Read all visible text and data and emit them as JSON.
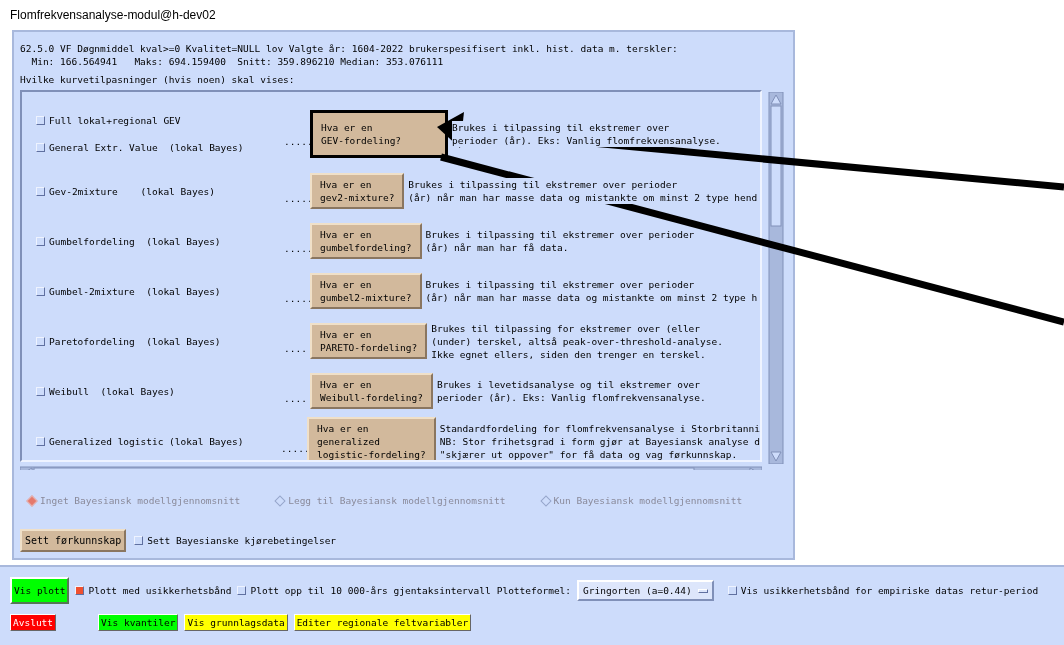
{
  "window": {
    "title": "Flomfrekvensanalyse-modul@h-dev02"
  },
  "header": {
    "lines": [
      "62.5.0 VF Døgnmiddel kval>=0 Kvalitet=NULL lov Valgte år: 1604-2022 brukerspesifisert inkl. hist. data m. terskler:",
      "  Min: 166.564941   Maks: 694.159400  Snitt: 359.896210 Median: 353.076111"
    ],
    "question": "Hvilke kurvetilpasninger (hvis noen) skal vises:"
  },
  "distributions": [
    {
      "options": [
        {
          "label": "Full lokal+regional GEV",
          "checked": false
        },
        {
          "label": "General Extr. Value  (lokal Bayes)",
          "checked": false
        }
      ],
      "dots": ".....",
      "button": {
        "lines": [
          "Hva er en",
          "GEV-fordeling?"
        ],
        "focused": true
      },
      "description": [
        "Brukes i tilpassing til ekstremer over",
        "perioder (år). Eks: Vanlig flomfrekvensanalyse."
      ]
    },
    {
      "options": [
        {
          "label": "Gev-2mixture    (lokal Bayes)",
          "checked": false
        }
      ],
      "dots": ".....",
      "button": {
        "lines": [
          "Hva er en",
          "gev2-mixture?"
        ],
        "focused": false
      },
      "description": [
        "Brukes i tilpassing til ekstremer over perioder",
        "(år) når man har masse data og mistankte om minst 2 type hend"
      ]
    },
    {
      "options": [
        {
          "label": "Gumbelfordeling  (lokal Bayes)",
          "checked": false
        }
      ],
      "dots": ".....",
      "button": {
        "lines": [
          "Hva er en",
          "gumbelfordeling?"
        ],
        "focused": false
      },
      "description": [
        "Brukes i tilpassing til ekstremer over perioder",
        "(år) når man har få data."
      ]
    },
    {
      "options": [
        {
          "label": "Gumbel-2mixture  (lokal Bayes)",
          "checked": false
        }
      ],
      "dots": ".....",
      "button": {
        "lines": [
          "Hva er en",
          "gumbel2-mixture?"
        ],
        "focused": false
      },
      "description": [
        "Brukes i tilpassing til ekstremer over perioder",
        "(år) når man har masse data og mistankte om minst 2 type h"
      ]
    },
    {
      "options": [
        {
          "label": "Paretofordeling  (lokal Bayes)",
          "checked": false
        }
      ],
      "dots": "....",
      "button": {
        "lines": [
          "Hva er en",
          "PARETO-fordeling?"
        ],
        "focused": false
      },
      "description": [
        "Brukes til tilpassing for ekstremer over (eller",
        "(under) terskel, altså peak-over-threshold-analyse.",
        "Ikke egnet ellers, siden den trenger en terskel."
      ]
    },
    {
      "options": [
        {
          "label": "Weibull  (lokal Bayes)",
          "checked": false
        }
      ],
      "dots": "....",
      "button": {
        "lines": [
          "Hva er en",
          "Weibull-fordeling?"
        ],
        "focused": false
      },
      "description": [
        "Brukes i levetidsanalyse og til ekstremer over",
        "perioder (år). Eks: Vanlig flomfrekvensanalyse."
      ]
    },
    {
      "options": [
        {
          "label": "Generalized logistic (lokal Bayes)",
          "checked": false
        }
      ],
      "dots": ".....",
      "button": {
        "lines": [
          "Hva er en",
          "generalized",
          "logistic-fordeling?"
        ],
        "focused": false
      },
      "description": [
        "Standardfordeling for flomfrekvensanalyse i Storbritanni",
        "NB: Stor frihetsgrad i form gjør at Bayesiansk analyse d",
        "\"skjærer ut oppover\" for få data og vag førkunnskap."
      ]
    }
  ],
  "averaging": [
    {
      "label": "Inget Bayesiansk modellgjennomsnitt",
      "selected": true,
      "disabled": true
    },
    {
      "label": "Legg til Bayesiansk modellgjennomsnitt",
      "selected": false,
      "disabled": true
    },
    {
      "label": "Kun Bayesiansk modellgjennomsnitt",
      "selected": false,
      "disabled": true
    }
  ],
  "prior_button": "Sett førkunnskap",
  "run_conditions": {
    "label": "Sett Bayesianske kjørebetingelser",
    "checked": false
  },
  "plot_row": {
    "plot_button": {
      "label": "Vis plott",
      "color": "#00ff00"
    },
    "options": [
      {
        "label": "Plott med usikkerhetsbånd",
        "checked": true
      },
      {
        "label": "Plott opp til 10 000-års gjentaksintervall",
        "checked": false
      }
    ],
    "formula_label": "Plotteformel:",
    "formula_value": "Gringorten (a=0.44)",
    "empirical": {
      "label": "Vis usikkerhetsbånd for empiriske datas retur-period",
      "checked": false
    }
  },
  "actions": [
    {
      "label": "Avslutt",
      "color": "#ff0000"
    },
    {
      "label": "Vis kvantiler",
      "color": "#00ff00"
    },
    {
      "label": "Vis grunnlagsdata",
      "color": "#ffff00"
    },
    {
      "label": "Editer regionale feltvariabler",
      "color": "#ffff00"
    }
  ]
}
